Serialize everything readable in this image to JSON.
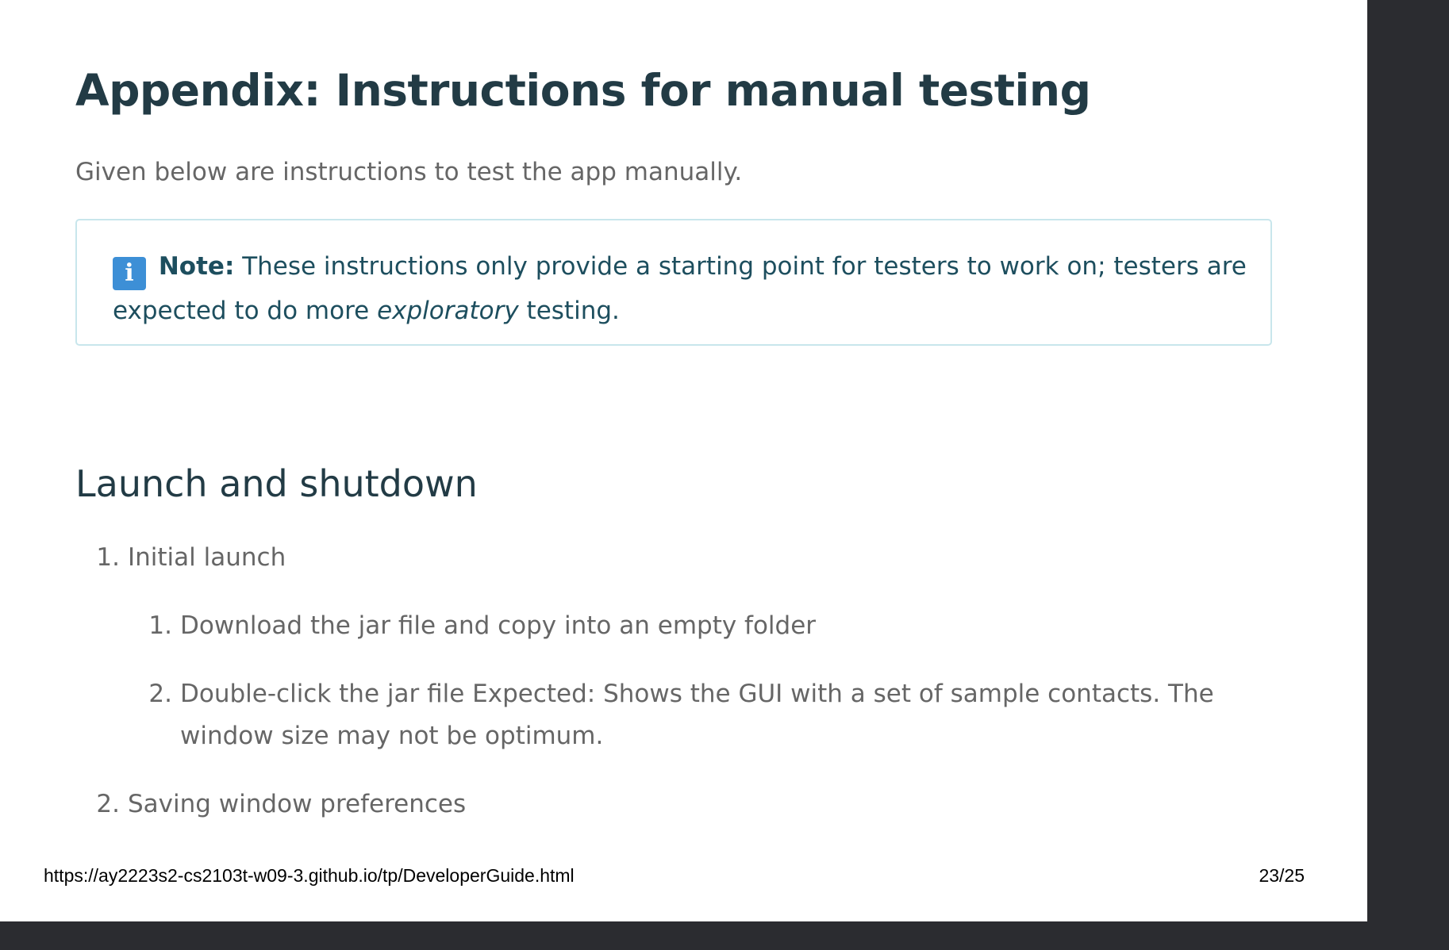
{
  "heading": "Appendix: Instructions for manual testing",
  "intro": "Given below are instructions to test the app manually.",
  "note": {
    "icon": "info-icon",
    "icon_glyph": "i",
    "label": "Note:",
    "text_before": " These instructions only provide a starting point for testers to work on; testers are expected to do more ",
    "emphasis": "exploratory",
    "text_after": " testing."
  },
  "section_title": "Launch and shutdown",
  "list": {
    "item1": {
      "number": "1.",
      "label": "Initial launch",
      "sub1": {
        "number": "1.",
        "text": "Download the jar file and copy into an empty folder"
      },
      "sub2": {
        "number": "2.",
        "text": "Double-click the jar file Expected: Shows the GUI with a set of sample contacts. The window size may not be optimum."
      }
    },
    "item2": {
      "number": "2.",
      "label": "Saving window preferences"
    }
  },
  "footer": {
    "url": "https://ay2223s2-cs2103t-w09-3.github.io/tp/DeveloperGuide.html",
    "page": "23/25"
  }
}
